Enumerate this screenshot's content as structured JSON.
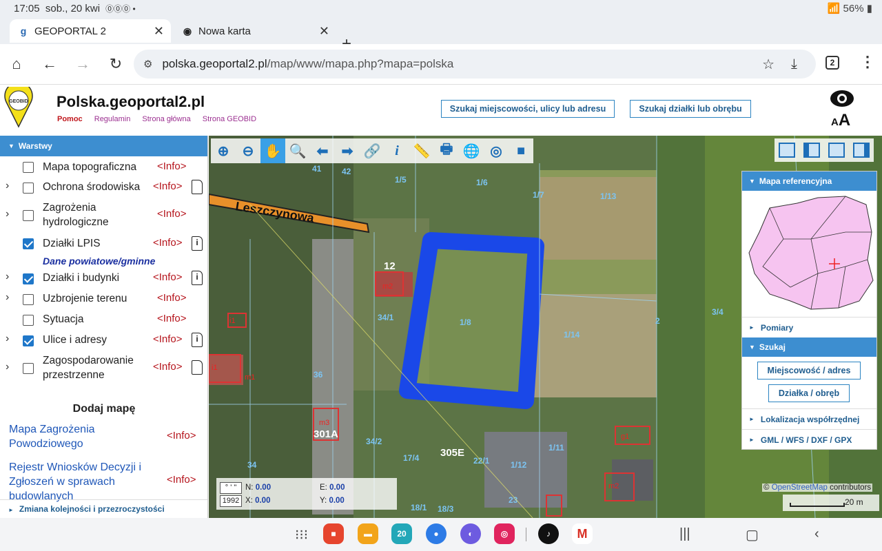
{
  "status": {
    "time": "17:05",
    "date": "sob., 20 kwi",
    "battery": "56%"
  },
  "tabs": [
    {
      "label": "GEOPORTAL 2"
    },
    {
      "label": "Nowa karta"
    }
  ],
  "browser": {
    "url_host": "polska.geoportal2.pl",
    "url_path": "/map/www/mapa.php?mapa=polska",
    "tab_count": "2"
  },
  "site": {
    "title": "Polska.geoportal2.pl",
    "logo_text": "GEOBID",
    "links": [
      "Pomoc",
      "Regulamin",
      "Strona główna",
      "Strona GEOBID"
    ],
    "search_address": "Szukaj miejscowości, ulicy lub adresu",
    "search_parcel": "Szukaj działki lub obrębu",
    "aa_label": "A",
    "aa_label_big": "A"
  },
  "layers_panel": {
    "title": "Warstwy",
    "items": [
      {
        "label": "Mapa topograficzna",
        "info": "<Info>",
        "checked": false
      },
      {
        "label": "Ochrona środowiska",
        "info": "<Info>",
        "checked": false
      },
      {
        "label": "Zagrożenia hydrologiczne",
        "info": "<Info>",
        "checked": false
      },
      {
        "label": "Działki LPIS",
        "info": "<Info>",
        "checked": true
      },
      {
        "label": "Działki i budynki",
        "info": "<Info>",
        "checked": true
      },
      {
        "label": "Uzbrojenie terenu",
        "info": "<Info>",
        "checked": false
      },
      {
        "label": "Sytuacja",
        "info": "<Info>",
        "checked": false
      },
      {
        "label": "Ulice i adresy",
        "info": "<Info>",
        "checked": true
      },
      {
        "label": "Zagospodarowanie przestrzenne",
        "info": "<Info>",
        "checked": false
      }
    ],
    "subheading": "Dane powiatowe/gminne",
    "add_map": "Dodaj mapę",
    "external": [
      {
        "label": "Mapa Zagrożenia Powodziowego",
        "info": "<Info>"
      },
      {
        "label": "Rejestr Wniosków Decyzji i Zgłoszeń w sprawach budowlanych",
        "info": "<Info>"
      }
    ],
    "bottom_link": "Zmiana kolejności i przezroczystości"
  },
  "right_panel": {
    "reference_map": "Mapa referencyjna",
    "measure": "Pomiary",
    "search": "Szukaj",
    "btn_place": "Miejscowość / adres",
    "btn_parcel": "Działka / obręb",
    "coords_loc": "Lokalizacja współrzędnej",
    "export": "GML / WFS / DXF / GPX"
  },
  "coords": {
    "fmt_btn": "° ' \"",
    "epsg_btn": "1992",
    "n_label": "N:",
    "n_val": "0.00",
    "e_label": "E:",
    "e_val": "0.00",
    "x_label": "X:",
    "x_val": "0.00",
    "y_label": "Y:",
    "y_val": "0.00"
  },
  "map": {
    "attrib_prefix": "©",
    "attrib_link": "OpenStreetMap",
    "attrib_suffix": "contributors",
    "scale": "20 m",
    "street": "Leszczynowa",
    "parcel_labels": [
      "1/5",
      "1/6",
      "1/7",
      "1/13",
      "1/8",
      "1/14",
      "2",
      "3/4",
      "12",
      "34/1",
      "m2",
      "m3",
      "i1",
      "m1",
      "36",
      "34/2",
      "17/4",
      "22/1",
      "1/12",
      "1/11",
      "23",
      "25",
      "305E",
      "301A",
      "18/1",
      "18/3",
      "34",
      "g1",
      "41",
      "42",
      "40",
      "4/5",
      "m2"
    ]
  },
  "sysnav": {
    "date_icon": "20"
  }
}
